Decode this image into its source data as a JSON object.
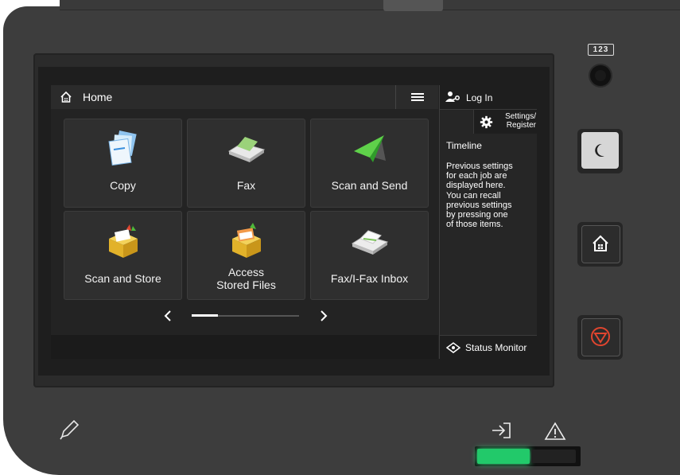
{
  "screen": {
    "header": {
      "title": "Home",
      "menu_icon": "hamburger-menu-icon"
    },
    "tiles": [
      {
        "label": "Copy",
        "icon": "copy-icon"
      },
      {
        "label": "Fax",
        "icon": "fax-icon"
      },
      {
        "label": "Scan and Send",
        "icon": "scan-send-icon"
      },
      {
        "label": "Scan and Store",
        "icon": "scan-store-icon"
      },
      {
        "label_line1": "Access",
        "label_line2": "Stored Files",
        "icon": "access-stored-files-icon"
      },
      {
        "label": "Fax/I-Fax Inbox",
        "icon": "fax-inbox-icon"
      }
    ],
    "pager": {
      "prev": "‹",
      "next": "›"
    },
    "sidebar": {
      "login_label": "Log In",
      "settings_line1": "Settings/",
      "settings_line2": "Register",
      "timeline_title": "Timeline",
      "timeline_text_lines": [
        "Previous settings",
        "for each job are",
        "displayed here.",
        "You can recall",
        "previous settings",
        "by pressing one",
        "of those items."
      ],
      "status_label": "Status Monitor"
    }
  },
  "hardware": {
    "counter_label": "123",
    "icons": [
      "moon-icon",
      "home-icon",
      "stop-icon",
      "pen-icon",
      "data-icon",
      "warning-icon"
    ],
    "colors": {
      "led": "#22c96a",
      "stop": "#e0452f",
      "body": "#3d3d3d"
    }
  }
}
